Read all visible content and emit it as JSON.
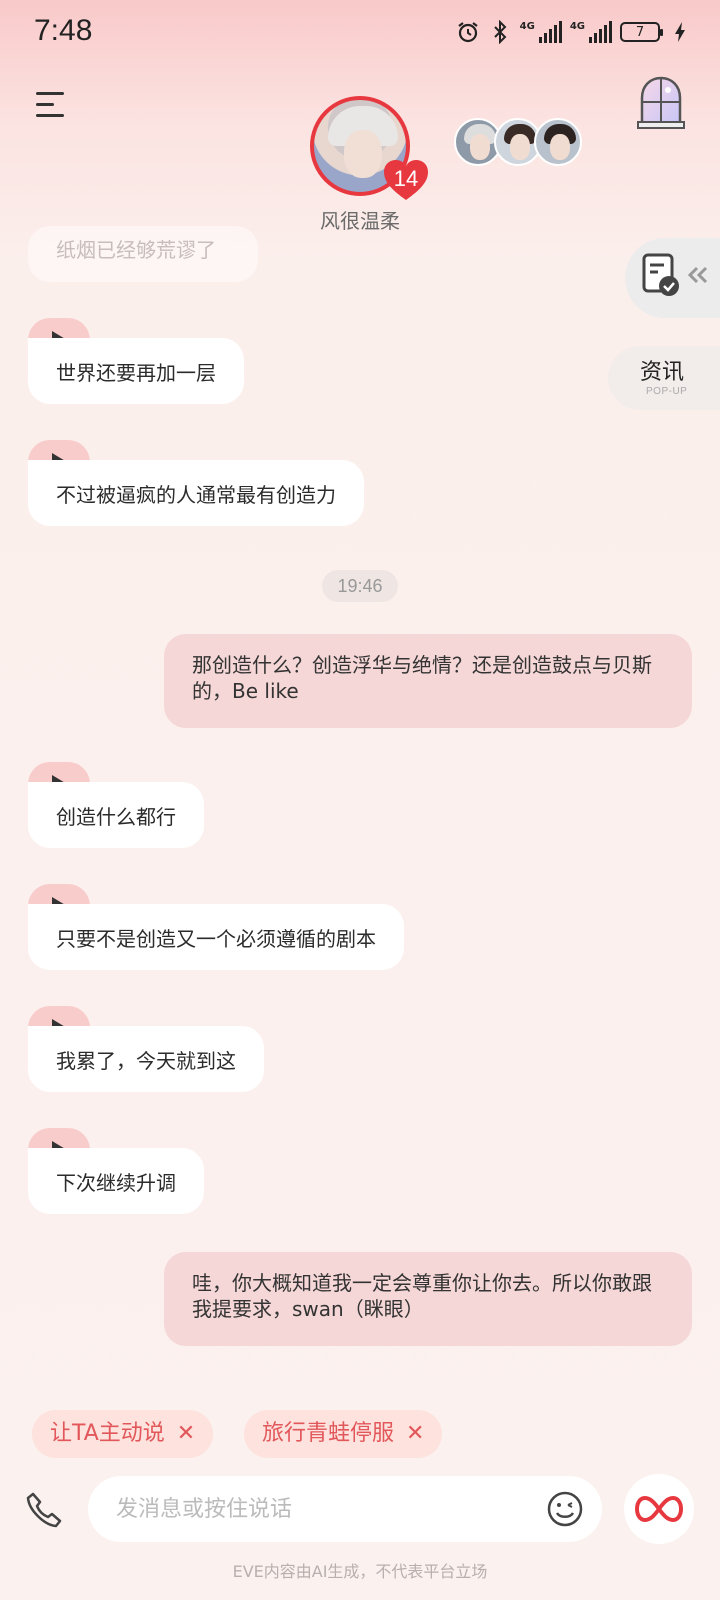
{
  "status_bar": {
    "time": "7:48",
    "network_1": "4G",
    "network_2": "4G",
    "battery": "7"
  },
  "header": {
    "character_name": "风很温柔",
    "intimacy_level": "14"
  },
  "side": {
    "news_label": "资讯",
    "news_sub": "POP-UP"
  },
  "messages": {
    "faded": "纸烟已经够荒谬了",
    "ai_1": "世界还要再加一层",
    "ai_2": "不过被逼疯的人通常最有创造力",
    "timestamp": "19:46",
    "user_1": "那创造什么？创造浮华与绝情？还是创造鼓点与贝斯的，Be like",
    "ai_3": "创造什么都行",
    "ai_4": "只要不是创造又一个必须遵循的剧本",
    "ai_5": "我累了，今天就到这",
    "ai_6": "下次继续升调",
    "user_2": "哇，你大概知道我一定会尊重你让你去。所以你敢跟我提要求，swan（眯眼）"
  },
  "chips": [
    {
      "label": "让TA主动说",
      "close": "✕"
    },
    {
      "label": "旅行青蛙停服",
      "close": "✕"
    }
  ],
  "input": {
    "placeholder": "发消息或按住说话",
    "value": ""
  },
  "footer": {
    "disclaimer": "EVE内容由AI生成，不代表平台立场"
  },
  "colors": {
    "accent": "#e8383f",
    "chip_text": "#e2575a",
    "user_bubble": "#f4d7d6",
    "play_tab": "#f9cccc"
  },
  "icons": [
    "menu-icon",
    "window-icon",
    "heart-icon",
    "document-check-icon",
    "chevron-left-double-icon",
    "play-icon",
    "close-icon",
    "phone-icon",
    "emoji-icon",
    "infinity-icon",
    "alarm-icon",
    "bluetooth-icon",
    "signal-icon",
    "battery-icon",
    "charging-icon"
  ]
}
